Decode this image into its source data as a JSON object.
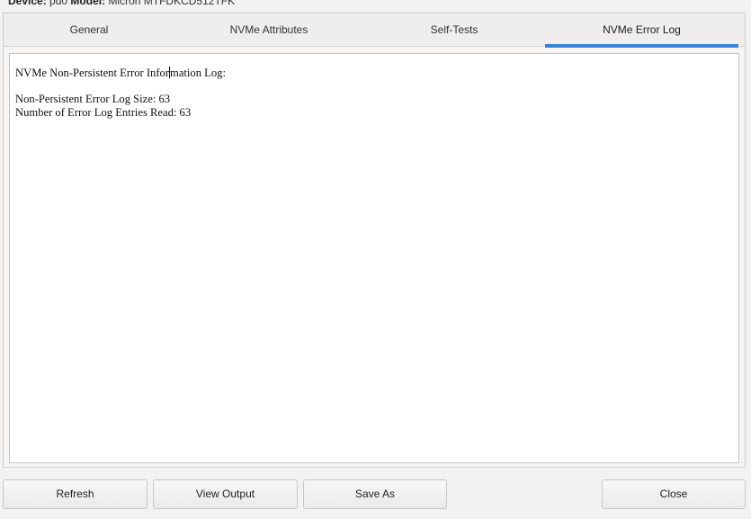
{
  "header": {
    "device_label": "Device:",
    "device_value": "pd0",
    "model_label": "Model:",
    "model_value": "Micron MTFDKCD512TFK"
  },
  "tabs": [
    {
      "label": "General",
      "active": false
    },
    {
      "label": "NVMe Attributes",
      "active": false
    },
    {
      "label": "Self-Tests",
      "active": false
    },
    {
      "label": "NVMe Error Log",
      "active": true
    }
  ],
  "log": {
    "title_before_caret": "NVMe Non-Persistent Error Infor",
    "title_after_caret": "mation Log:",
    "lines": [
      "Non-Persistent Error Log Size: 63",
      "Number of Error Log Entries Read: 63"
    ]
  },
  "buttons": {
    "refresh": "Refresh",
    "view_output": "View Output",
    "save_as": "Save As",
    "close": "Close"
  },
  "colors": {
    "accent": "#3c84d6",
    "window_bg": "#f3f2f1"
  }
}
